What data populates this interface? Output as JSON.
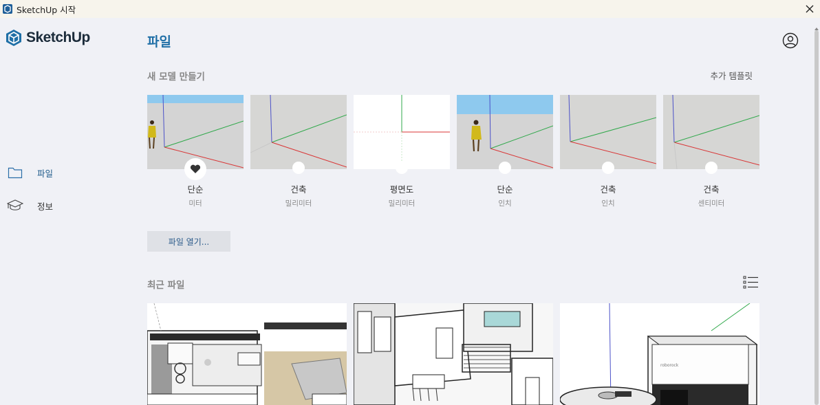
{
  "window": {
    "title": "SketchUp 시작"
  },
  "brand": {
    "name": "SketchUp",
    "color": "#1f6fa6"
  },
  "sidebar": {
    "items": [
      {
        "label": "파일",
        "icon": "folder-icon",
        "active": true
      },
      {
        "label": "정보",
        "icon": "graduation-cap-icon",
        "active": false
      }
    ]
  },
  "main": {
    "title": "파일",
    "new_model": {
      "heading": "새 모델 만들기",
      "more_label": "추가 템플릿",
      "templates": [
        {
          "name": "단순",
          "unit": "미터",
          "style": "sky-figure",
          "favorite": true
        },
        {
          "name": "건축",
          "unit": "밀리미터",
          "style": "grey",
          "favorite": false
        },
        {
          "name": "평면도",
          "unit": "밀리미터",
          "style": "plan",
          "favorite": false
        },
        {
          "name": "단순",
          "unit": "인치",
          "style": "sky-figure",
          "favorite": false
        },
        {
          "name": "건축",
          "unit": "인치",
          "style": "grey",
          "favorite": false
        },
        {
          "name": "건축",
          "unit": "센티미터",
          "style": "grey",
          "favorite": false
        }
      ]
    },
    "open_button": "파일 열기...",
    "recent": {
      "heading": "최근 파일",
      "view_icon": "list-view-icon",
      "files": [
        {
          "thumbnail": "interior-floorplan-3d"
        },
        {
          "thumbnail": "apartment-floorplan-3d"
        },
        {
          "thumbnail": "robot-vacuum-station"
        }
      ]
    }
  },
  "colors": {
    "background": "#f0f1f6",
    "accent": "#1f6fa6",
    "sky": "#8ec9ee"
  }
}
